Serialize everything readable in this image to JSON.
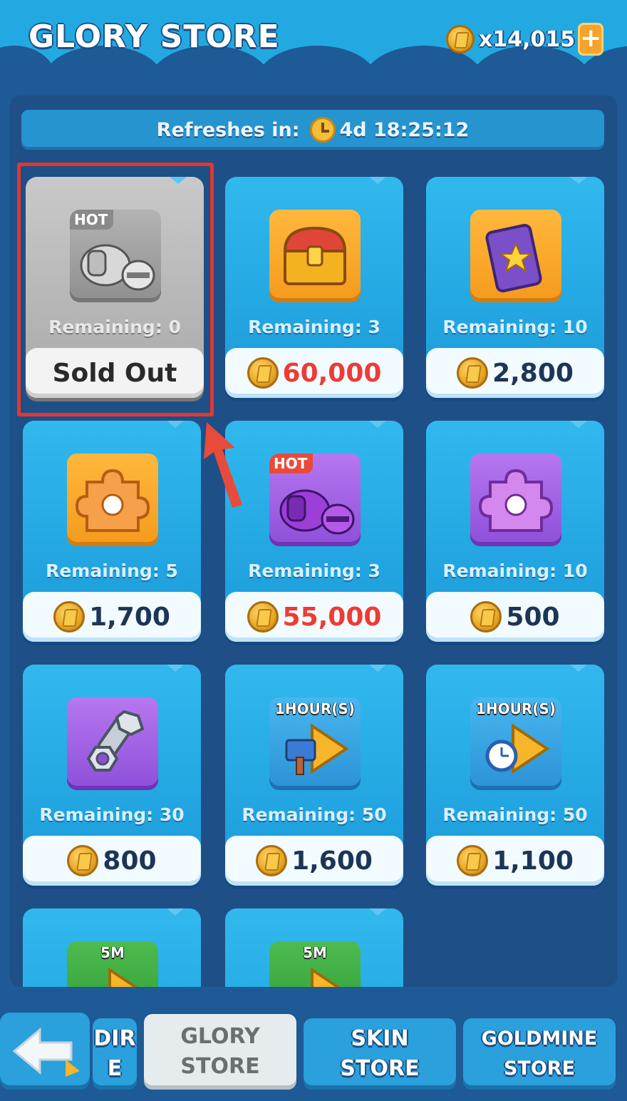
{
  "header": {
    "title": "GLORY STORE",
    "currency_amount": "x14,015",
    "add_symbol": "+"
  },
  "refresh": {
    "label": "Refreshes in:",
    "timer": "4d 18:25:12"
  },
  "items": [
    {
      "icon": "armor-chest-icon",
      "badge": "HOT",
      "remaining": "Remaining: 0",
      "price": "Sold Out",
      "sold_out": true
    },
    {
      "icon": "treasure-chest-icon",
      "remaining": "Remaining: 3",
      "price": "60,000",
      "price_color": "#ee3b36"
    },
    {
      "icon": "star-card-icon",
      "remaining": "Remaining: 10",
      "price": "2,800"
    },
    {
      "icon": "orange-puzzle-piece-icon",
      "remaining": "Remaining: 5",
      "price": "1,700"
    },
    {
      "icon": "purple-armor-icon",
      "badge": "HOT",
      "remaining": "Remaining: 3",
      "price": "55,000",
      "price_color": "#ee3b36"
    },
    {
      "icon": "purple-puzzle-piece-icon",
      "remaining": "Remaining: 10",
      "price": "500"
    },
    {
      "icon": "bolt-nut-icon",
      "remaining": "Remaining: 30",
      "price": "800"
    },
    {
      "icon": "hammer-speedup-icon",
      "duration": "1HOUR(S)",
      "remaining": "Remaining: 50",
      "price": "1,600"
    },
    {
      "icon": "clock-speedup-icon",
      "duration": "1HOUR(S)",
      "remaining": "Remaining: 50",
      "price": "1,100"
    },
    {
      "icon": "speedup-icon",
      "duration": "5M"
    },
    {
      "icon": "speedup-icon",
      "duration": "5M"
    }
  ],
  "nav": {
    "partial_tab_line1": "DIR",
    "partial_tab_line2": "E",
    "glory_line1": "GLORY",
    "glory_line2": "STORE",
    "skin_line1": "SKIN",
    "skin_line2": "STORE",
    "goldmine_line1": "GOLDMINE",
    "goldmine_line2": "STORE"
  },
  "colors": {
    "background": "#1d5a96",
    "card": "#1a9ad9",
    "price_red": "#ee3b36",
    "highlight": "#e3372f",
    "coin": "#e8a623"
  }
}
